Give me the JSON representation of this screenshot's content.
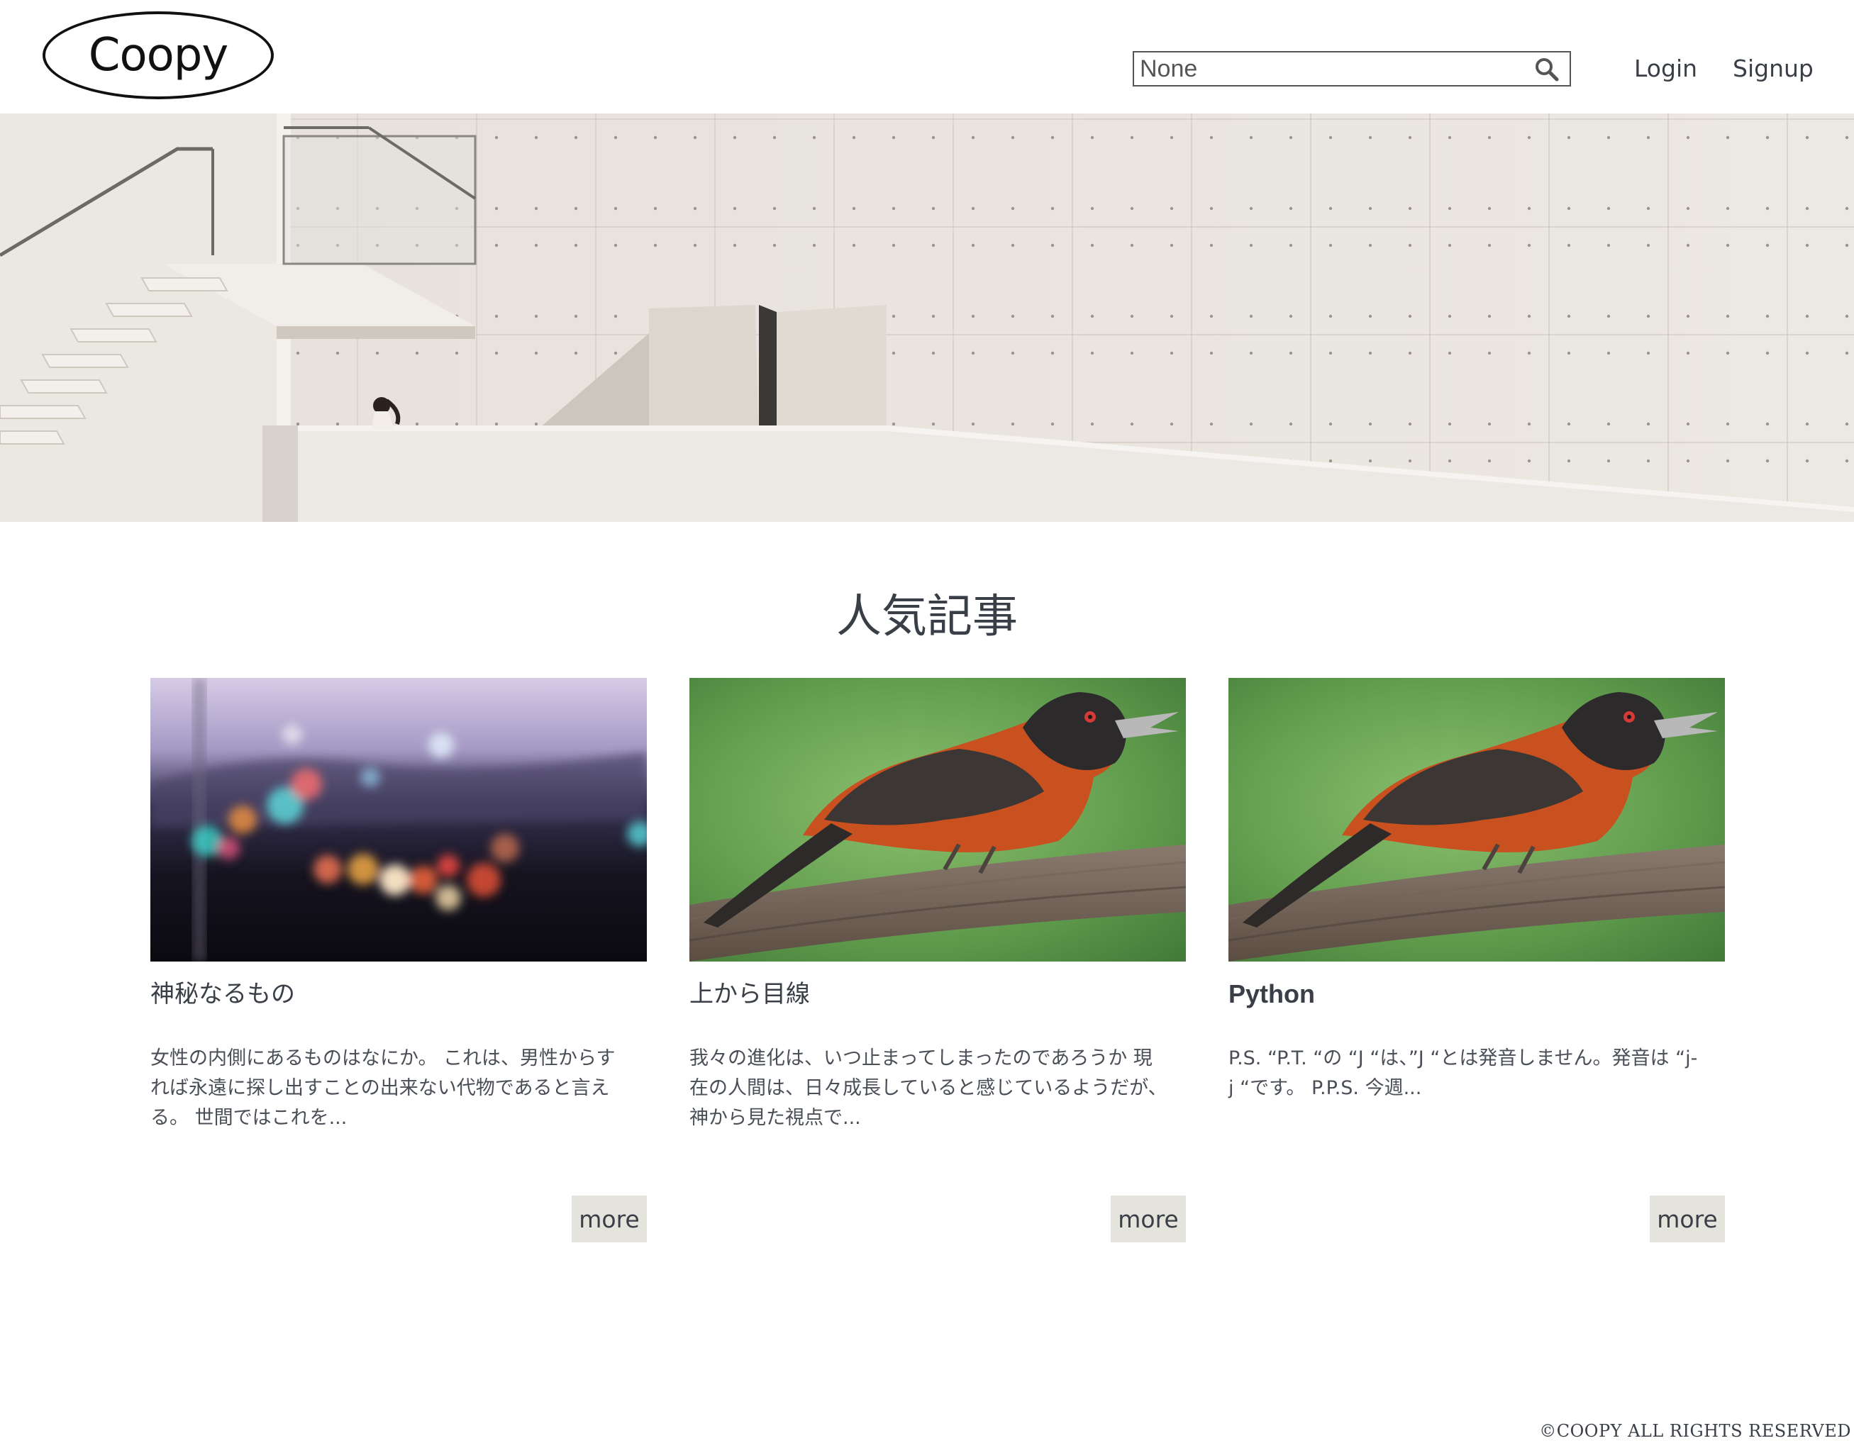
{
  "header": {
    "logo_text": "Coopy",
    "search": {
      "placeholder": "None",
      "value": ""
    },
    "nav": {
      "login": "Login",
      "signup": "Signup"
    }
  },
  "hero": {
    "image": "concrete-architecture-stairs-photo"
  },
  "section": {
    "title": "人気記事"
  },
  "articles": [
    {
      "title": "神秘なるもの",
      "image": "bokeh-city-lights-photo",
      "excerpt_lines": [
        "女性の内側にあるものはなにか。 これは、男性からす",
        "れば永遠に探し出すことの出来ない代物であると言え",
        "る。 世間ではこれを..."
      ],
      "more_label": "more"
    },
    {
      "title": "上から目線",
      "image": "orange-bird-on-branch-photo",
      "excerpt_lines": [
        "我々の進化は、いつ止まってしまったのであろうか 現",
        "在の人間は、日々成長していると感じているようだが、",
        "神から見た視点で..."
      ],
      "more_label": "more"
    },
    {
      "title": "Python",
      "image": "orange-bird-on-branch-photo",
      "excerpt_lines": [
        "P.S. “P.T. “の “J “は、”J “とは発音しません。発音は “j-",
        "j “です。 P.P.S. 今週..."
      ],
      "more_label": "more"
    }
  ],
  "footer": {
    "copyright": "©COOPY ALL RIGHTS RESERVED"
  },
  "colors": {
    "text": "#3a3f47",
    "button_bg": "#e4e4dc",
    "hero_wall": "#e9e4de"
  }
}
